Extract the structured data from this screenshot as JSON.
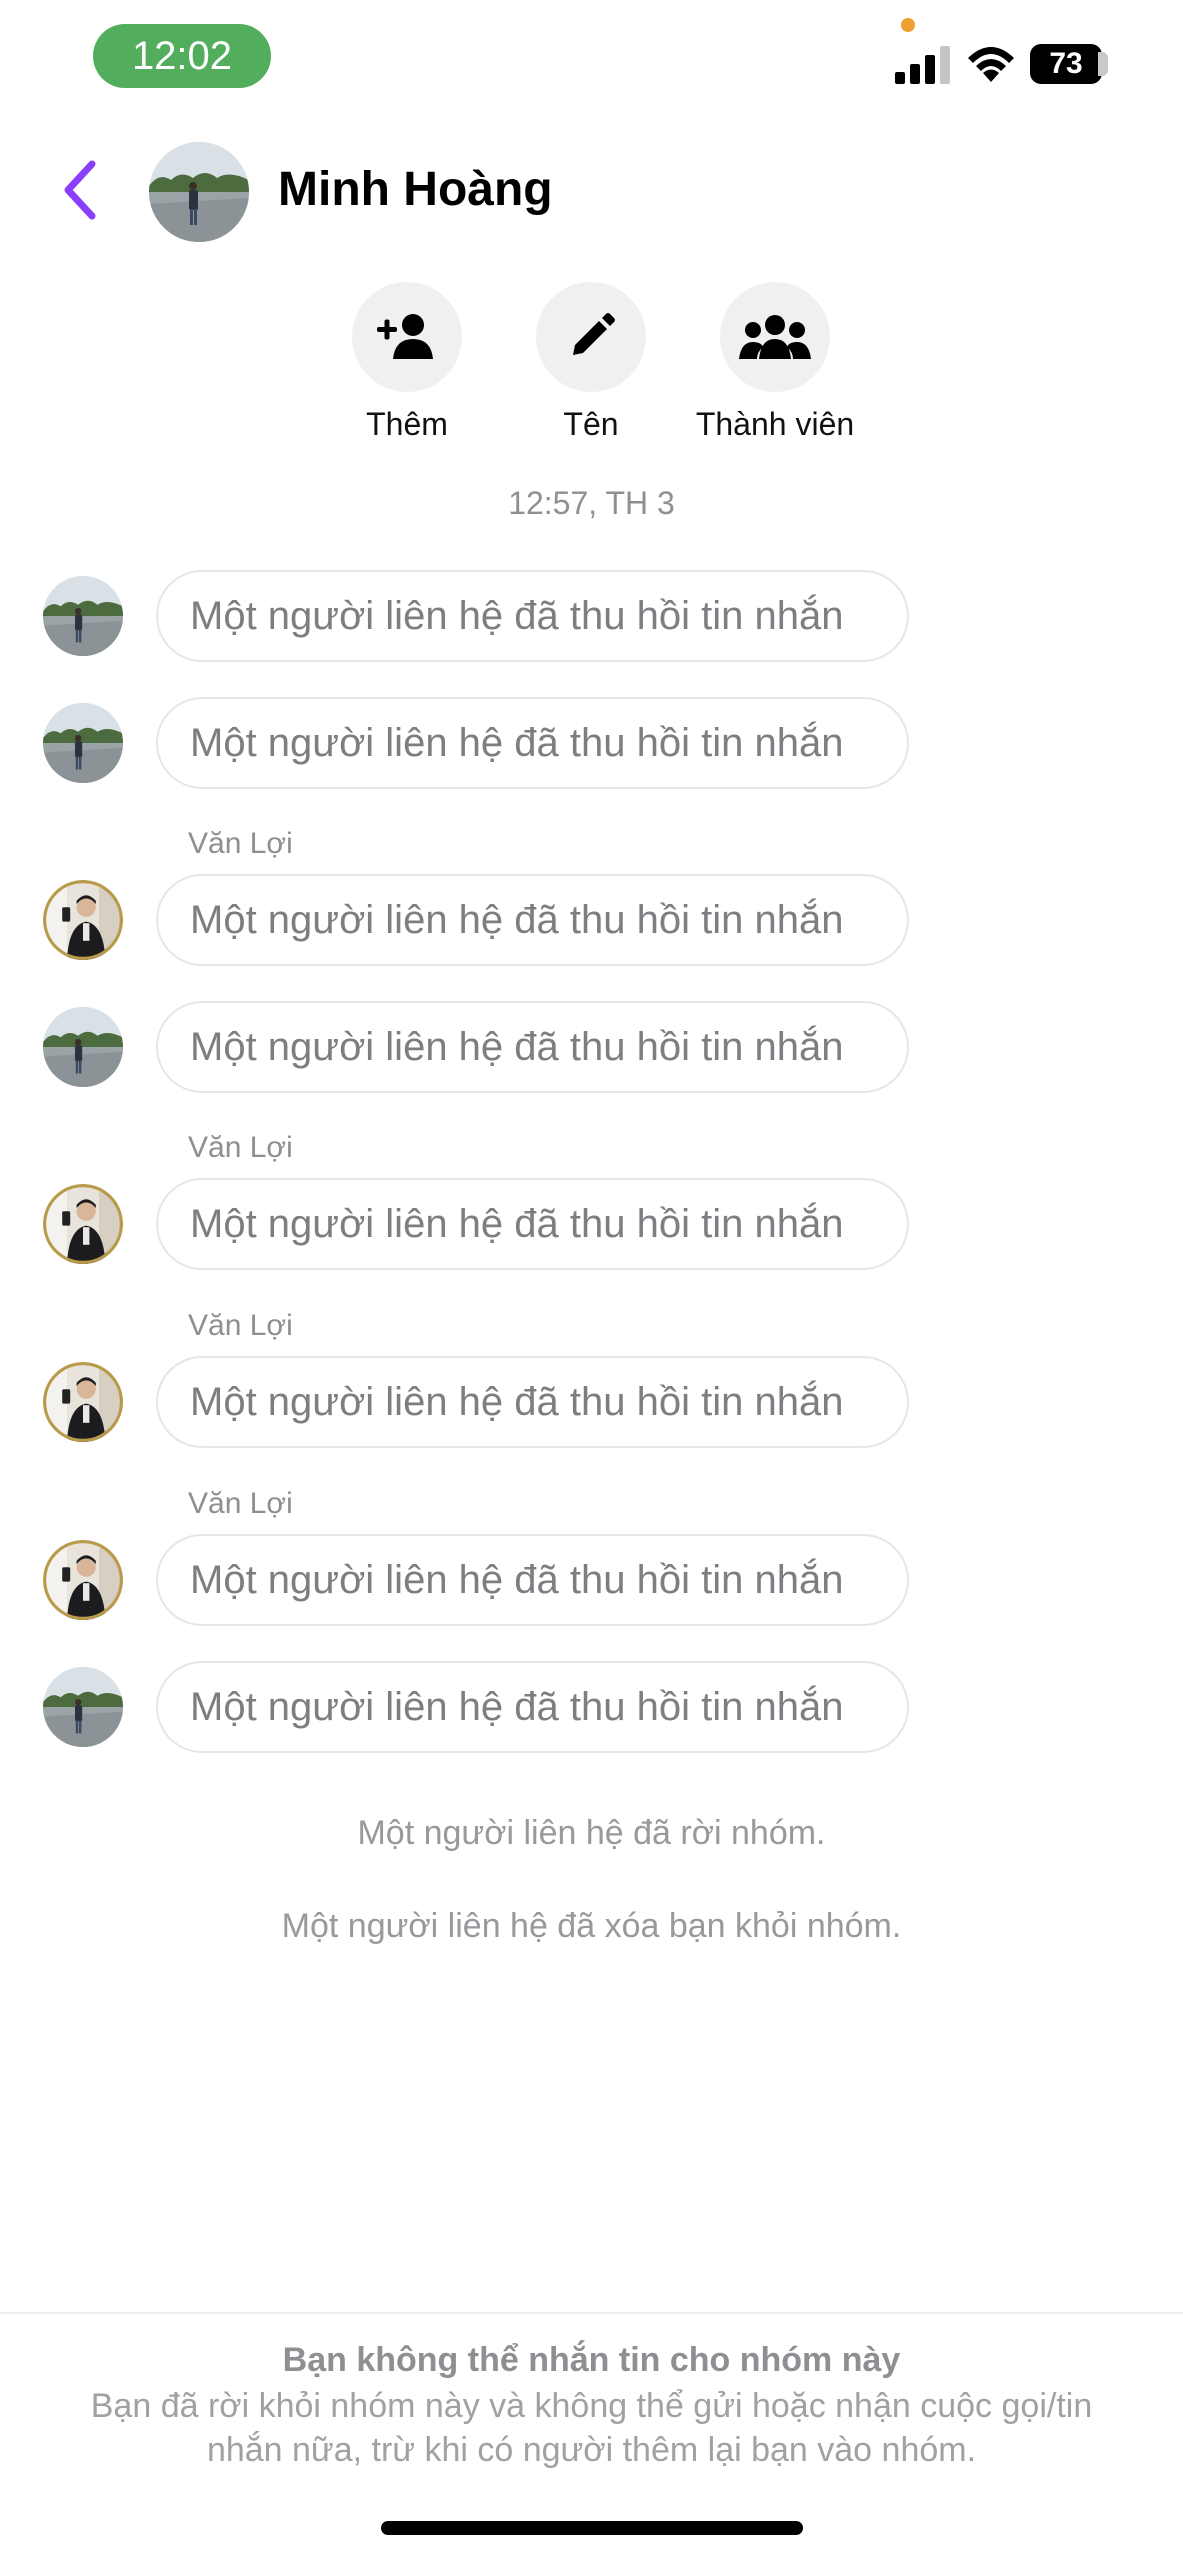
{
  "status_bar": {
    "time": "12:02",
    "battery": "73"
  },
  "header": {
    "title": "Minh Hoàng"
  },
  "actions": [
    {
      "label": "Thêm"
    },
    {
      "label": "Tên"
    },
    {
      "label": "Thành viên"
    }
  ],
  "timestamp": "12:57, TH 3",
  "messages": [
    {
      "sender": "",
      "text": "Một người liên hệ đã thu hồi tin nhắn"
    },
    {
      "sender": "",
      "text": "Một người liên hệ đã thu hồi tin nhắn"
    },
    {
      "sender": "Văn Lợi",
      "text": "Một người liên hệ đã thu hồi tin nhắn"
    },
    {
      "sender": "",
      "text": "Một người liên hệ đã thu hồi tin nhắn"
    },
    {
      "sender": "Văn Lợi",
      "text": "Một người liên hệ đã thu hồi tin nhắn"
    },
    {
      "sender": "Văn Lợi",
      "text": "Một người liên hệ đã thu hồi tin nhắn"
    },
    {
      "sender": "Văn Lợi",
      "text": "Một người liên hệ đã thu hồi tin nhắn"
    },
    {
      "sender": "",
      "text": "Một người liên hệ đã thu hồi tin nhắn"
    }
  ],
  "system_messages": [
    "Một người liên hệ đã rời nhóm.",
    "Một người liên hệ đã xóa bạn khỏi nhóm."
  ],
  "footer": {
    "title": "Bạn không thể nhắn tin cho nhóm này",
    "body": "Bạn đã rời khỏi nhóm này và không thể gửi hoặc nhận cuộc gọi/tin nhắn nữa, trừ khi có người thêm lại bạn vào nhóm."
  },
  "colors": {
    "accent": "#8a3ffc",
    "status_time_bg": "#52ad5c",
    "bubble_border": "#e6e6ea",
    "muted_text": "#8e8e93"
  }
}
